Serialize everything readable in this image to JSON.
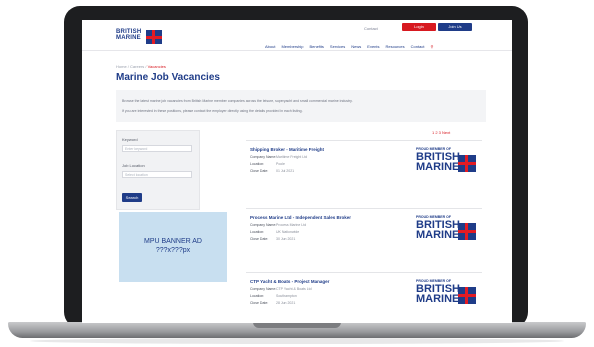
{
  "site": {
    "logo_line1": "BRITISH",
    "logo_line2": "MARINE",
    "top_links": "Contact",
    "btn_primary": "Login",
    "btn_secondary": "Join Us",
    "nav": [
      "About",
      "Membership",
      "Benefits",
      "Services",
      "News",
      "Events",
      "Resources",
      "Contact"
    ]
  },
  "page": {
    "breadcrumb_home": "Home",
    "breadcrumb_sep": "/",
    "breadcrumb_section": "Careers",
    "breadcrumb_current": "Vacancies",
    "title": "Marine Job Vacancies",
    "intro_line1": "Browse the latest marine job vacancies from British Marine member companies across the leisure, superyacht and small commercial marine industry.",
    "intro_line2": "If you are interested in these positions, please contact the employer directly using the details provided in each listing.",
    "pager": "1  2  3  Next"
  },
  "filter": {
    "keyword_label": "Keyword",
    "keyword_placeholder": "Enter keyword",
    "location_label": "Job Location",
    "location_placeholder": "Select location",
    "search_button": "Search"
  },
  "banner": {
    "line1": "MPU BANNER AD",
    "line2": "???x???px"
  },
  "jobs": [
    {
      "title": "Shipping Broker - Maritime Freight",
      "company_label": "Company Name:",
      "company": "Maritime Freight Ltd",
      "location_label": "Location:",
      "location": "Poole",
      "closing_label": "Close Date:",
      "closing": "01 Jul 2021"
    },
    {
      "title": "Process Marine Ltd - Independent Sales Broker",
      "company_label": "Company Name:",
      "company": "Process Marine Ltd",
      "location_label": "Location:",
      "location": "UK Nationwide",
      "closing_label": "Close Date:",
      "closing": "30 Jun 2021"
    },
    {
      "title": "CTP Yacht & Boats - Project Manager",
      "company_label": "Company Name:",
      "company": "CTP Yacht & Boats Ltd",
      "location_label": "Location:",
      "location": "Southampton",
      "closing_label": "Close Date:",
      "closing": "28 Jun 2021"
    }
  ],
  "badge": {
    "proud": "PROUD MEMBER OF",
    "line1": "BRITISH",
    "line2": "MARINE"
  },
  "colors": {
    "brand_blue": "#1f3c88",
    "brand_red": "#d71920",
    "banner_bg": "#c8dff0"
  }
}
